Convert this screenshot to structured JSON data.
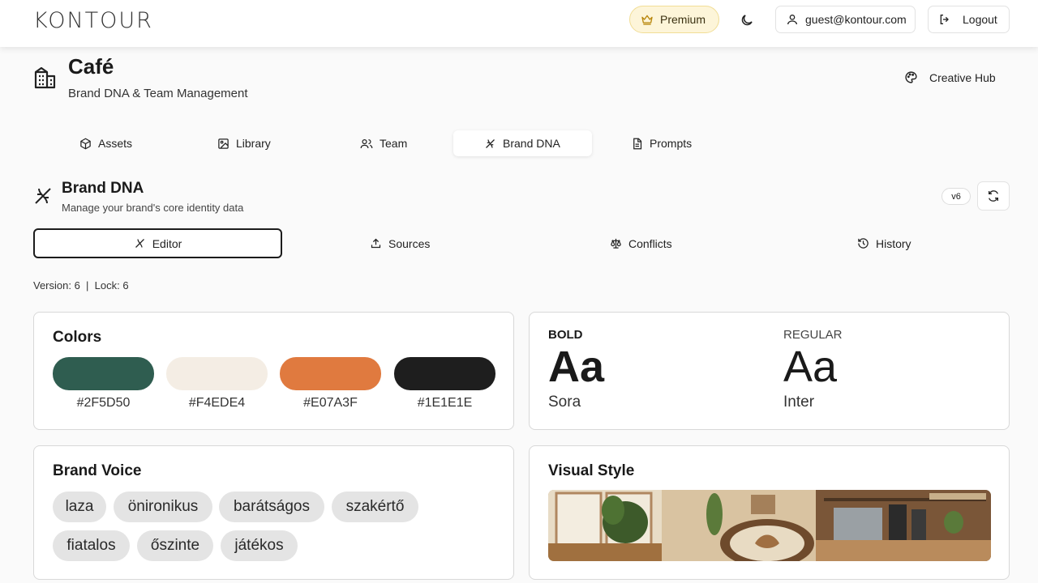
{
  "header": {
    "logo": "KONTOUR",
    "premium_label": "Premium",
    "user_email": "guest@kontour.com",
    "logout_label": "Logout"
  },
  "workspace": {
    "title": "Café",
    "subtitle": "Brand DNA & Team Management",
    "creative_hub_label": "Creative Hub"
  },
  "tabs": [
    {
      "label": "Assets"
    },
    {
      "label": "Library"
    },
    {
      "label": "Team"
    },
    {
      "label": "Brand DNA",
      "active": true
    },
    {
      "label": "Prompts"
    }
  ],
  "brand_dna": {
    "title": "Brand DNA",
    "subtitle": "Manage your brand's core identity data",
    "version_badge": "v6",
    "subtabs": [
      {
        "label": "Editor",
        "active": true
      },
      {
        "label": "Sources"
      },
      {
        "label": "Conflicts"
      },
      {
        "label": "History"
      }
    ],
    "meta": "Version: 6  |  Lock: 6"
  },
  "colors_card": {
    "title": "Colors",
    "swatches": [
      "#2F5D50",
      "#F4EDE4",
      "#E07A3F",
      "#1E1E1E"
    ]
  },
  "typography_card": {
    "bold_label": "BOLD",
    "bold_sample": "Aa",
    "bold_font": "Sora",
    "regular_label": "REGULAR",
    "regular_sample": "Aa",
    "regular_font": "Inter"
  },
  "voice_card": {
    "title": "Brand Voice",
    "tags": [
      "laza",
      "öniron­ikus",
      "barátságos",
      "szakértő",
      "fiatalos",
      "őszinte",
      "játékos"
    ]
  },
  "visual_card": {
    "title": "Visual Style"
  }
}
